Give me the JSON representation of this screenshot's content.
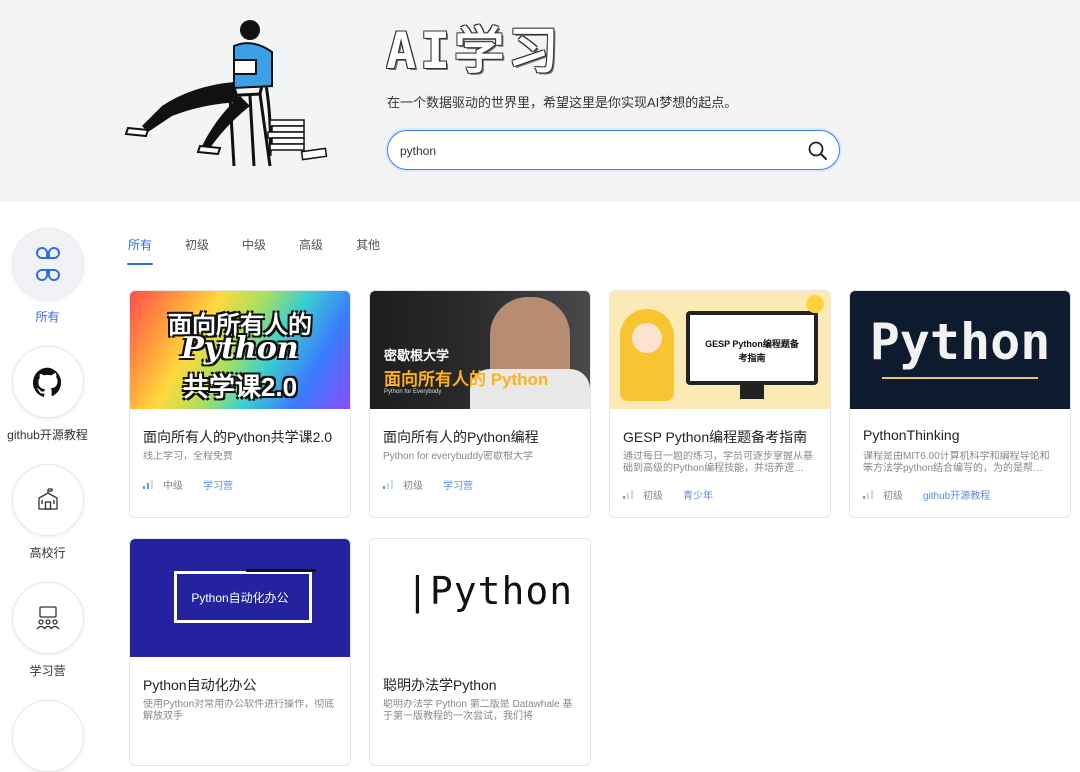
{
  "hero": {
    "title": "AI学习",
    "subtitle": "在一个数据驱动的世界里，希望这里是你实现AI梦想的起点。",
    "search": {
      "value": "python",
      "placeholder": ""
    }
  },
  "sidebar": {
    "items": [
      {
        "label": "所有",
        "icon": "grid-icon",
        "active": true
      },
      {
        "label": "github开源教程",
        "icon": "github-icon"
      },
      {
        "label": "高校行",
        "icon": "school-icon"
      },
      {
        "label": "学习营",
        "icon": "camp-icon"
      }
    ]
  },
  "tabs": [
    {
      "label": "所有",
      "active": true
    },
    {
      "label": "初级"
    },
    {
      "label": "中级"
    },
    {
      "label": "高级"
    },
    {
      "label": "其他"
    }
  ],
  "cards": [
    {
      "title": "面向所有人的Python共学课2.0",
      "desc": "线上学习，全程免费",
      "level": "中级",
      "tag": "学习营",
      "thumb_lines": [
        "面向所有人的",
        "Python",
        "共学课2.0"
      ]
    },
    {
      "title": "面向所有人的Python编程",
      "desc": "Python for everybuddy密歇根大学",
      "level": "初级",
      "tag": "学习营",
      "thumb_lines": [
        "密歇根大学",
        "面向所有人的 Python",
        "Python for Everybody"
      ]
    },
    {
      "title": "GESP Python编程题备考指南",
      "desc": "通过每日一题的练习，学员可逐步掌握从基础到高级的Python编程技能，并培养逻…",
      "level": "初级",
      "tag": "青少年",
      "thumb_lines": [
        "GESP Python编程题备",
        "考指南"
      ]
    },
    {
      "title": "PythonThinking",
      "desc": "课程是由MIT6.00计算机科学和编程导论和笨方法学python结合编写的，为的是帮…",
      "level": "初级",
      "tag": "github开源教程",
      "thumb_lines": [
        "Python"
      ]
    },
    {
      "title": "Python自动化办公",
      "desc": "使用Python对常用办公软件进行操作，彻底解放双手",
      "thumb_lines": [
        "Python自动化办公"
      ]
    },
    {
      "title": "聪明办法学Python",
      "desc": "聪明办法学 Python 第二版是 Datawhale 基于第一版教程的一次尝试，我们将",
      "thumb_lines": [
        "|Python"
      ]
    }
  ]
}
